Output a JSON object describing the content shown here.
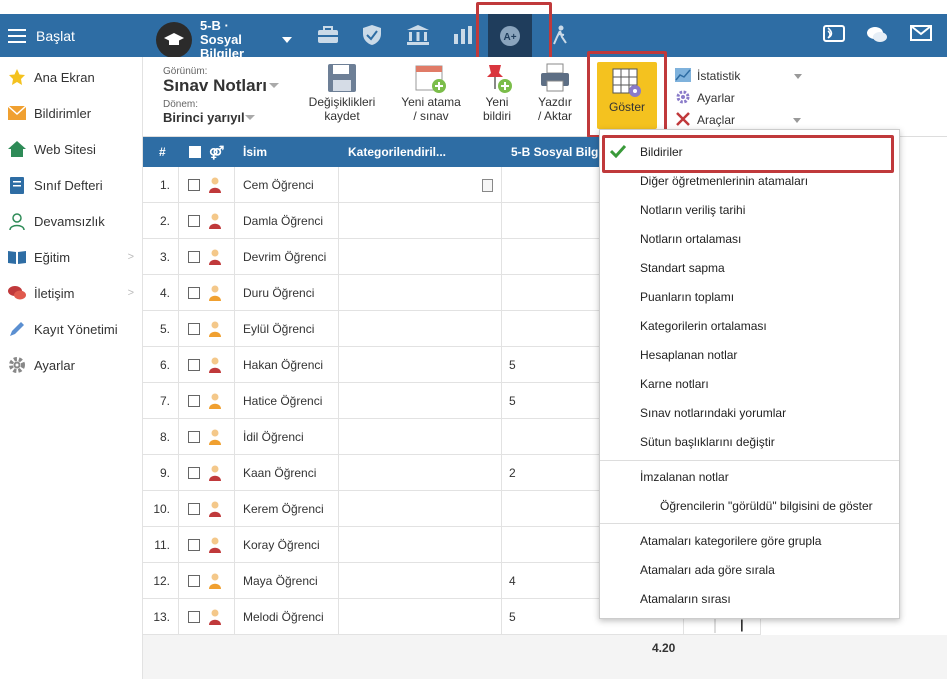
{
  "nav": {
    "brand": "Başlat",
    "class_name": "5-B · Sosyal Bilgiler"
  },
  "sidebar": {
    "items": [
      {
        "label": "Ana Ekran",
        "icon": "star-icon"
      },
      {
        "label": "Bildirimler",
        "icon": "envelope-icon"
      },
      {
        "label": "Web Sitesi",
        "icon": "home-icon"
      },
      {
        "label": "Sınıf Defteri",
        "icon": "notebook-icon"
      },
      {
        "label": "Devamsızlık",
        "icon": "person-icon"
      },
      {
        "label": "Eğitim",
        "icon": "book-icon"
      },
      {
        "label": "İletişim",
        "icon": "chat-icon"
      },
      {
        "label": "Kayıt Yönetimi",
        "icon": "pen-icon"
      },
      {
        "label": "Ayarlar",
        "icon": "gear-icon"
      }
    ]
  },
  "toolbar": {
    "view_label": "Görünüm:",
    "view_value": "Sınav Notları",
    "period_label": "Dönem:",
    "period_value": "Birinci yarıyıl",
    "save_line1": "Değişiklikleri",
    "save_line2": "kaydet",
    "new_exam_line1": "Yeni atama",
    "new_exam_line2": "/ sınav",
    "new_notice_line1": "Yeni",
    "new_notice_line2": "bildiri",
    "print_line1": "Yazdır",
    "print_line2": "/ Aktar",
    "show_label": "Göster",
    "stats_label": "İstatistik",
    "settings_label": "Ayarlar",
    "tools_label": "Araçlar"
  },
  "table": {
    "headers": {
      "num": "#",
      "name": "İsim",
      "cat": "Kategorilendiril...",
      "subject": "5-B Sosyal Bilgi..."
    },
    "rows": [
      {
        "n": "1.",
        "name": "Cem Öğrenci",
        "val": "",
        "g": "m"
      },
      {
        "n": "2.",
        "name": "Damla Öğrenci",
        "val": "",
        "g": "m"
      },
      {
        "n": "3.",
        "name": "Devrim Öğrenci",
        "val": "",
        "g": "m"
      },
      {
        "n": "4.",
        "name": "Duru Öğrenci",
        "val": "",
        "g": "f"
      },
      {
        "n": "5.",
        "name": "Eylül Öğrenci",
        "val": "",
        "g": "f"
      },
      {
        "n": "6.",
        "name": "Hakan Öğrenci",
        "val": "5",
        "g": "m"
      },
      {
        "n": "7.",
        "name": "Hatice Öğrenci",
        "val": "5",
        "g": "f"
      },
      {
        "n": "8.",
        "name": "İdil Öğrenci",
        "val": "",
        "g": "f"
      },
      {
        "n": "9.",
        "name": "Kaan Öğrenci",
        "val": "2",
        "g": "m"
      },
      {
        "n": "10.",
        "name": "Kerem Öğrenci",
        "val": "",
        "g": "m"
      },
      {
        "n": "11.",
        "name": "Koray Öğrenci",
        "val": "",
        "g": "m"
      },
      {
        "n": "12.",
        "name": "Maya Öğrenci",
        "val": "4",
        "g": "f"
      },
      {
        "n": "13.",
        "name": "Melodi Öğrenci",
        "val": "5",
        "g": "m"
      }
    ],
    "average": "4.20"
  },
  "dropdown": {
    "items": [
      {
        "label": "Bildiriler",
        "checked": true
      },
      {
        "label": "Diğer öğretmenlerinin atamaları"
      },
      {
        "label": "Notların veriliş tarihi"
      },
      {
        "label": "Notların ortalaması"
      },
      {
        "label": "Standart sapma"
      },
      {
        "label": "Puanların toplamı"
      },
      {
        "label": "Kategorilerin ortalaması"
      },
      {
        "label": "Hesaplanan notlar"
      },
      {
        "label": "Karne notları"
      },
      {
        "label": "Sınav notlarındaki yorumlar"
      },
      {
        "label": "Sütun başlıklarını değiştir"
      },
      {
        "label": "İmzalanan notlar"
      },
      {
        "label": "Öğrencilerin \"görüldü\" bilgisini de göster"
      },
      {
        "label": "Atamaları kategorilere göre grupla"
      },
      {
        "label": "Atamaları ada göre sırala"
      },
      {
        "label": "Atamaların sırası"
      }
    ]
  },
  "colors": {
    "nav": "#2e6da4",
    "accent": "#f4c21f",
    "highlight": "#c0393b",
    "check": "#3a9a3a"
  }
}
